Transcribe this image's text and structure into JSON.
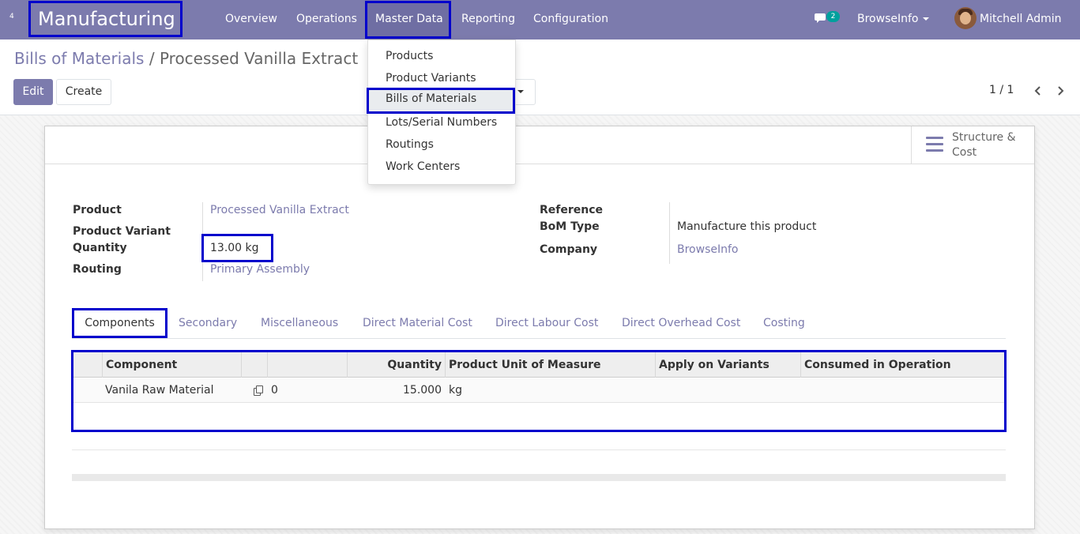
{
  "nav": {
    "app_badge": "4",
    "app_title": "Manufacturing",
    "menus": [
      "Overview",
      "Operations",
      "Master Data",
      "Reporting",
      "Configuration"
    ],
    "chat_count": "2",
    "company": "BrowseInfo",
    "user": "Mitchell Admin"
  },
  "dropdown": {
    "items": [
      "Products",
      "Product Variants",
      "Bills of Materials",
      "Lots/Serial Numbers",
      "Routings",
      "Work Centers"
    ],
    "active": "Bills of Materials"
  },
  "breadcrumb": {
    "parent": "Bills of Materials",
    "separator": "/",
    "current": "Processed Vanilla Extract"
  },
  "buttons": {
    "edit": "Edit",
    "create": "Create"
  },
  "pager": {
    "value": "1 / 1"
  },
  "smart_button": {
    "label": "Structure & Cost",
    "icon": "bars-icon"
  },
  "form": {
    "product_label": "Product",
    "product_value": "Processed Vanilla Extract",
    "variant_label": "Product Variant",
    "quantity_label": "Quantity",
    "quantity_value": "13.00 kg",
    "routing_label": "Routing",
    "routing_value": "Primary Assembly",
    "reference_label": "Reference",
    "bom_type_label": "BoM Type",
    "bom_type_value": "Manufacture this product",
    "company_label": "Company",
    "company_value": "BrowseInfo"
  },
  "tabs": [
    "Components",
    "Secondary",
    "Miscellaneous",
    "Direct Material Cost",
    "Direct Labour Cost",
    "Direct Overhead Cost",
    "Costing"
  ],
  "table": {
    "headers": [
      "Component",
      "",
      "",
      "Quantity",
      "Product Unit of Measure",
      "Apply on Variants",
      "Consumed in Operation"
    ],
    "rows": [
      {
        "component": "Vanila Raw Material",
        "col3": "0",
        "quantity": "15.000",
        "uom": "kg",
        "variants": "",
        "operation": ""
      }
    ]
  },
  "colors": {
    "brand": "#7c7bad",
    "highlight": "#0000cc",
    "badge": "#00a09d"
  }
}
